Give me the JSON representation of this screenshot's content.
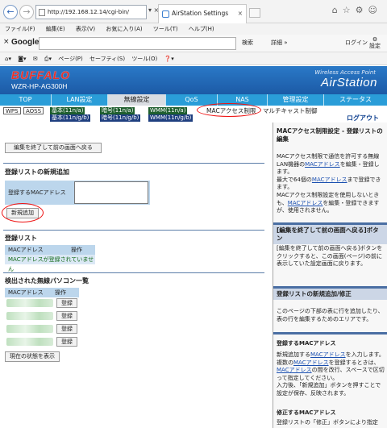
{
  "browser": {
    "url": "http://192.168.12.14/cgi-bin/",
    "tab_title": "AirStation Settings",
    "menu": [
      "ファイル(F)",
      "編集(E)",
      "表示(V)",
      "お気に入り(A)",
      "ツール(T)",
      "ヘルプ(H)"
    ],
    "google_label": "Google",
    "search_button": "検索",
    "more_label": "詳細 »",
    "login_label": "ログイン",
    "settings_label": "設定",
    "command_items": [
      "ページ(P)",
      "セーフティ(S)",
      "ツール(O)"
    ]
  },
  "header": {
    "logo": "BUFFALO",
    "model": "WZR-HP-AG300H",
    "tagline": "Wireless Access Point",
    "product": "AirStation"
  },
  "nav_tabs": [
    "TOP",
    "LAN設定",
    "無線設定",
    "QoS",
    "NAS",
    "管理設定",
    "ステータス"
  ],
  "active_tab": "無線設定",
  "sub_nav": {
    "wps": "WPS",
    "aoss": "AOSS",
    "basic_a": "基本(11n/a)",
    "basic_g": "基本(11n/g/b)",
    "security_a": "暗号(11n/a)",
    "security_g": "暗号(11n/g/b)",
    "wmm_a": "WMM(11n/a)",
    "wmm_g": "WMM(11n/g/b)",
    "mac_filter": "MACアクセス制限",
    "multicast": "マルチキャスト制御",
    "logout": "ログアウト"
  },
  "main": {
    "back_button": "編集を終了して前の画面へ戻る",
    "new_section_title": "登録リストの新規追加",
    "mac_label": "登録するMACアドレス",
    "mac_value": "",
    "add_button": "新規追加",
    "list_title": "登録リスト",
    "list_col_mac": "MACアドレス",
    "list_col_op": "操作",
    "list_empty": "MACアドレスが登録されていません",
    "detected_title": "検出された無線パソコン一覧",
    "detected_col_mac": "MACアドレス",
    "detected_col_op": "操作",
    "detected_rows": [
      {
        "mac": "",
        "action": "登録"
      },
      {
        "mac": "",
        "action": "登録"
      },
      {
        "mac": "",
        "action": "登録"
      },
      {
        "mac": "",
        "action": "登録"
      }
    ],
    "refresh_button": "現在の状態を表示"
  },
  "help": {
    "title": "MACアクセス制限設定 - 登録リストの編集",
    "p1": "MACアクセス制限で通信を許可する無線LAN機器の",
    "p1_link": "MACアドレス",
    "p1b": "を編集・登録します。",
    "p2": "最大で64個の",
    "p2_link": "MACアドレス",
    "p2b": "まで登録できます。",
    "p3": "MACアクセス制限設定を使用しないときも、",
    "p3_link": "MACアドレス",
    "p3b": "を編集・登録できますが、使用されません。",
    "back_title": "[編集を終了して前の画面へ戻る]ボタン",
    "back_text": "[編集を終了して前の画面へ戻る]ボタンをクリックすると、この画面(ページ)の前に表示していた設定画面に戻ります。",
    "edit_title": "登録リストの新規追加/修正",
    "edit_text": "このページの下部の表に行を追加したり、表の行を編集するためのエリアです。",
    "mac_title": "登録するMACアドレス",
    "mac_text1": "新規追加する",
    "mac_text1_link": "MACアドレス",
    "mac_text1b": "を入力します。",
    "mac_text2": "複数の",
    "mac_text2_link": "MACアドレス",
    "mac_text2b": "を登録するときは、",
    "mac_text3_link": "MACアドレス",
    "mac_text3b": "の間を改行、スペースで区切って指定してください。",
    "mac_text4": "入力後、「新規追加」ボタンを押すことで設定が保存、反映されます。",
    "fix_title": "修正するMACアドレス",
    "fix_text": "登録リストの「修正」ボタンにより指定"
  }
}
